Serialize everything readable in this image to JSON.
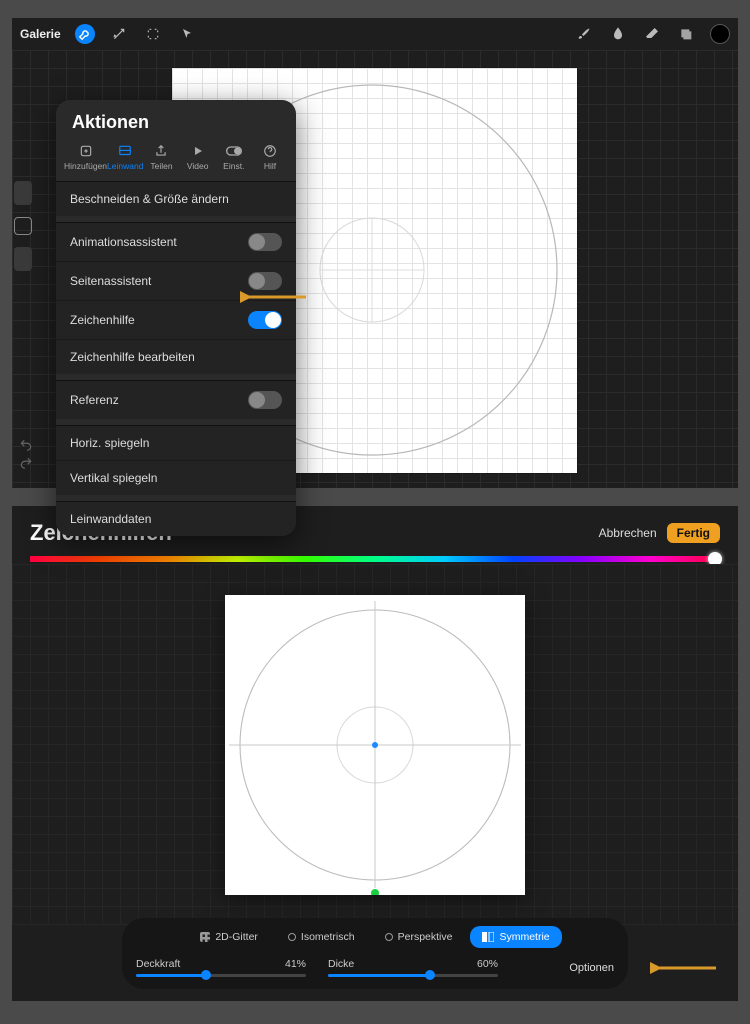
{
  "topbar": {
    "gallery": "Galerie"
  },
  "popover": {
    "title": "Aktionen",
    "tabs": [
      {
        "label": "Hinzufügen"
      },
      {
        "label": "Leinwand"
      },
      {
        "label": "Teilen"
      },
      {
        "label": "Video"
      },
      {
        "label": "Einst."
      },
      {
        "label": "Hilf"
      }
    ],
    "crop": "Beschneiden & Größe ändern",
    "anim": "Animationsassistent",
    "page": "Seitenassistent",
    "guide": "Zeichenhilfe",
    "guide_edit": "Zeichenhilfe bearbeiten",
    "reference": "Referenz",
    "fliph": "Horiz. spiegeln",
    "flipv": "Vertikal spiegeln",
    "canvasdata": "Leinwanddaten"
  },
  "bottom": {
    "title": "Zeichenhilfen",
    "cancel": "Abbrechen",
    "done": "Fertig",
    "modes": {
      "grid2d": "2D-Gitter",
      "iso": "Isometrisch",
      "persp": "Perspektive",
      "sym": "Symmetrie"
    },
    "opacity_label": "Deckkraft",
    "opacity_value": "41%",
    "thickness_label": "Dicke",
    "thickness_value": "60%",
    "options": "Optionen"
  }
}
